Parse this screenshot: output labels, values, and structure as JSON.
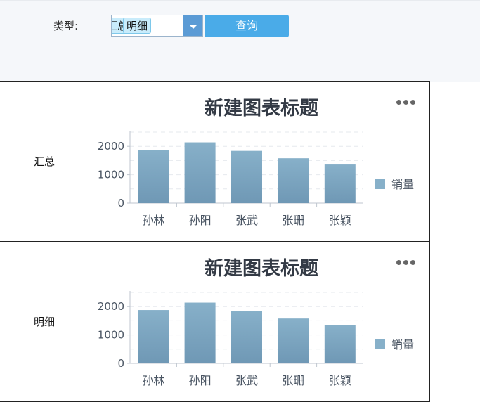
{
  "filter": {
    "label": "类型:",
    "tag_partial": "汇总",
    "tag_selected": "明细",
    "query_label": "查询"
  },
  "rows": [
    {
      "label": "汇总"
    },
    {
      "label": "明细"
    }
  ],
  "more_icon": "more-horizontal-icon",
  "colors": {
    "bar_top": "#87b0c9",
    "bar_bottom": "#6f98b5",
    "query_button": "#4aabe8"
  },
  "chart_data": [
    {
      "type": "bar",
      "title": "新建图表标题",
      "categories": [
        "孙林",
        "孙阳",
        "张武",
        "张珊",
        "张颖"
      ],
      "series": [
        {
          "name": "销量",
          "values": [
            1880,
            2140,
            1840,
            1580,
            1360
          ]
        }
      ],
      "yticks": [
        "0",
        "1000",
        "2000"
      ],
      "ylim": [
        0,
        2500
      ],
      "grid": true,
      "legend": "right"
    },
    {
      "type": "bar",
      "title": "新建图表标题",
      "categories": [
        "孙林",
        "孙阳",
        "张武",
        "张珊",
        "张颖"
      ],
      "series": [
        {
          "name": "销量",
          "values": [
            1880,
            2140,
            1840,
            1580,
            1360
          ]
        }
      ],
      "yticks": [
        "0",
        "1000",
        "2000"
      ],
      "ylim": [
        0,
        2500
      ],
      "grid": true,
      "legend": "right"
    }
  ]
}
